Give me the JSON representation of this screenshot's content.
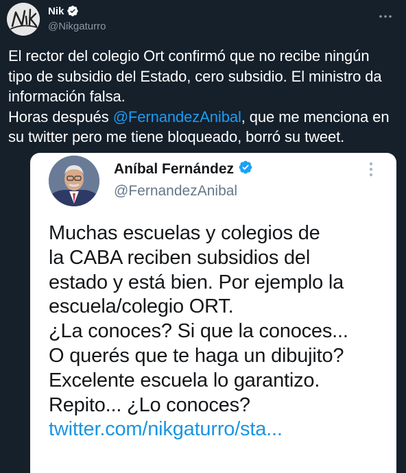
{
  "tweet": {
    "author_name": "Nik",
    "author_handle": "@Nikgaturro",
    "avatar_signature": "Nik",
    "verified": true,
    "text_part1": "El rector del colegio Ort confirmó que no recibe ningún tipo de subsidio del Estado, cero subsidio. El ministro da información falsa.",
    "text_part2_prefix": "Horas después ",
    "mention": "@FernandezAnibal",
    "text_part2_suffix": ", que me menciona en su twitter pero me tiene bloqueado, borró su tweet."
  },
  "embedded_tweet": {
    "author_name": "Aníbal Fernández",
    "author_handle": "@FernandezAnibal",
    "verified": true,
    "lines": [
      "Muchas escuelas y colegios de",
      "la CABA reciben subsidios del",
      "estado y está bien. Por ejemplo la",
      "escuela/colegio ORT.",
      "¿La conoces? Si que la conoces...",
      "O querés que te haga un dibujito?",
      "Excelente escuela lo garantizo.",
      "Repito... ¿Lo conoces?"
    ],
    "link": "twitter.com/nikgaturro/sta..."
  },
  "colors": {
    "background": "#15202b",
    "accent": "#1d9bf0",
    "secondary_text": "#8b98a5"
  },
  "icons": [
    "verified-badge-icon",
    "more-options-icon"
  ]
}
